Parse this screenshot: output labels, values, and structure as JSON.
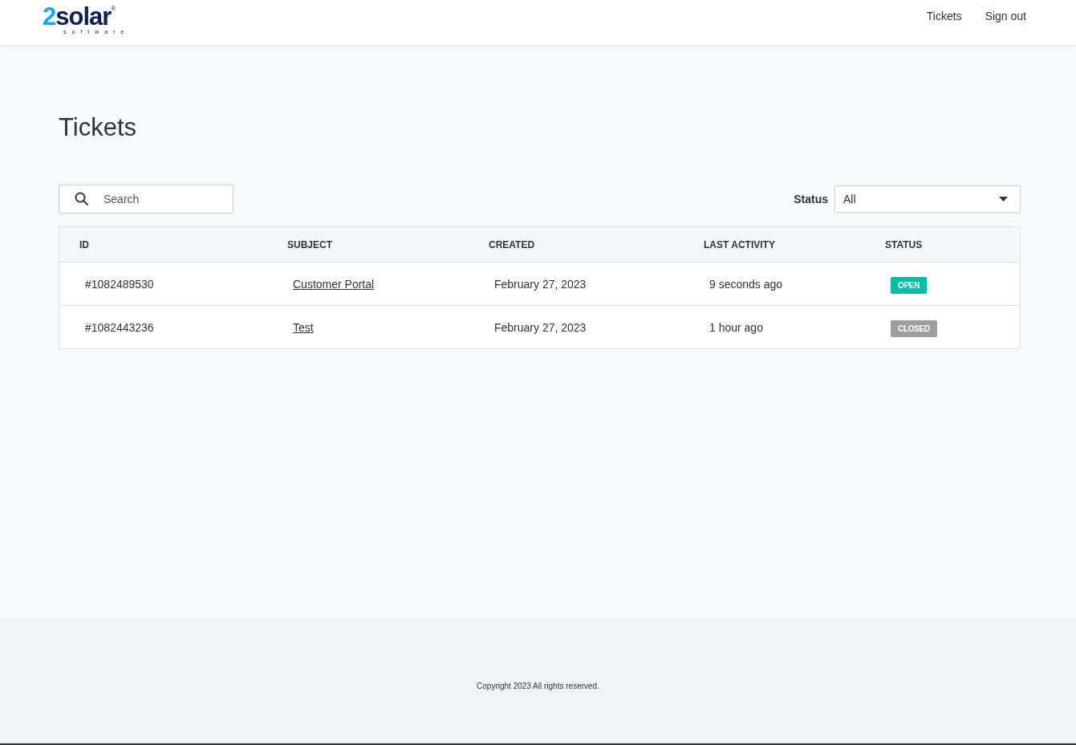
{
  "header": {
    "logo": {
      "digit": "2",
      "word": "solar",
      "mark": "®",
      "tagline": "software"
    },
    "nav": [
      "Tickets",
      "Sign out"
    ]
  },
  "page_title": "Tickets",
  "search": {
    "placeholder": "Search"
  },
  "status_filter": {
    "label": "Status",
    "value": "All"
  },
  "table": {
    "columns": [
      "ID",
      "SUBJECT",
      "CREATED",
      "LAST ACTIVITY",
      "STATUS"
    ],
    "rows": [
      {
        "id": "#1082489530",
        "subject": "Customer Portal",
        "created": "February 27, 2023",
        "last_activity": "9 seconds ago",
        "status": "OPEN",
        "color": "#00bfa5"
      },
      {
        "id": "#1082443236",
        "subject": "Test",
        "created": "February 27, 2023",
        "last_activity": "1 hour ago",
        "status": "CLOSED",
        "color": "#9e9e9e"
      }
    ]
  },
  "footer": {
    "copyright": "Copyright 2023 All rights reserved."
  }
}
